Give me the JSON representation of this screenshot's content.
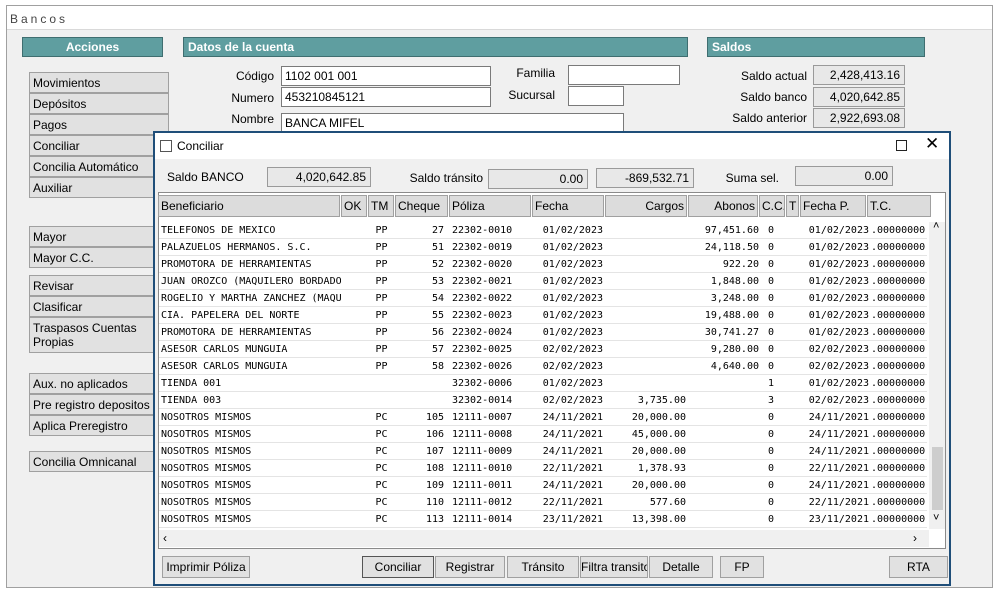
{
  "window": {
    "title": "Bancos"
  },
  "actions": {
    "header": "Acciones",
    "buttons": [
      {
        "id": "movimientos",
        "label": "Movimientos"
      },
      {
        "id": "depositos",
        "label": "Depósitos"
      },
      {
        "id": "pagos",
        "label": "Pagos"
      },
      {
        "id": "conciliar",
        "label": "Conciliar"
      },
      {
        "id": "concilia-automatico",
        "label": "Concilia Automático"
      },
      {
        "id": "auxiliar",
        "label": "Auxiliar"
      },
      {
        "id": "mayor",
        "label": "Mayor"
      },
      {
        "id": "mayor-cc",
        "label": "Mayor C.C."
      },
      {
        "id": "revisar",
        "label": "Revisar"
      },
      {
        "id": "clasificar",
        "label": "Clasificar"
      },
      {
        "id": "traspasos",
        "label": "Traspasos  Cuentas Propias"
      },
      {
        "id": "aux-no-aplicados",
        "label": "Aux. no aplicados"
      },
      {
        "id": "pre-registro",
        "label": "Pre registro depositos"
      },
      {
        "id": "aplica-preregistro",
        "label": "Aplica Preregistro"
      },
      {
        "id": "concilia-omnicanal",
        "label": "Concilia Omnicanal"
      }
    ]
  },
  "account": {
    "header": "Datos de la cuenta",
    "codigo_label": "Código",
    "codigo": "1102 001 001",
    "numero_label": "Numero",
    "numero": "453210845121",
    "nombre_label": "Nombre",
    "nombre": "BANCA MIFEL",
    "familia_label": "Familia",
    "familia": "",
    "sucursal_label": "Sucursal",
    "sucursal": ""
  },
  "saldos": {
    "header": "Saldos",
    "actual_label": "Saldo actual",
    "actual": "2,428,413.16",
    "banco_label": "Saldo banco",
    "banco": "4,020,642.85",
    "anterior_label": "Saldo anterior",
    "anterior": "2,922,693.08"
  },
  "dialog": {
    "title": "Conciliar",
    "saldo_banco_label": "Saldo BANCO",
    "saldo_banco": "4,020,642.85",
    "saldo_transito_label": "Saldo tránsito",
    "saldo_transito": "0.00",
    "saldo_transito2": "-869,532.71",
    "suma_sel_label": "Suma sel.",
    "suma_sel": "0.00",
    "columns": {
      "beneficiario": "Beneficiario",
      "ok": "OK",
      "tm": "TM",
      "cheque": "Cheque",
      "poliza": "Póliza",
      "fecha": "Fecha",
      "cargos": "Cargos",
      "abonos": "Abonos",
      "cc": "C.C.",
      "t": "T",
      "fechap": "Fecha P.",
      "tc": "T.C."
    },
    "rows": [
      {
        "ben": "TELEFONOS DE MEXICO",
        "ok": "",
        "tm": "PP",
        "chq": "27",
        "pol": "22302-0010",
        "fec": "01/02/2023",
        "car": "",
        "abo": "97,451.60",
        "cc": "0",
        "fp": "01/02/2023",
        "tc": ".00000000"
      },
      {
        "ben": "PALAZUELOS HERMANOS. S.C.",
        "ok": "",
        "tm": "PP",
        "chq": "51",
        "pol": "22302-0019",
        "fec": "01/02/2023",
        "car": "",
        "abo": "24,118.50",
        "cc": "0",
        "fp": "01/02/2023",
        "tc": ".00000000"
      },
      {
        "ben": "PROMOTORA DE HERRAMIENTAS",
        "ok": "",
        "tm": "PP",
        "chq": "52",
        "pol": "22302-0020",
        "fec": "01/02/2023",
        "car": "",
        "abo": "922.20",
        "cc": "0",
        "fp": "01/02/2023",
        "tc": ".00000000"
      },
      {
        "ben": "JUAN OROZCO (MAQUILERO BORDADO",
        "ok": "",
        "tm": "PP",
        "chq": "53",
        "pol": "22302-0021",
        "fec": "01/02/2023",
        "car": "",
        "abo": "1,848.00",
        "cc": "0",
        "fp": "01/02/2023",
        "tc": ".00000000"
      },
      {
        "ben": "ROGELIO Y MARTHA ZANCHEZ (MAQU",
        "ok": "",
        "tm": "PP",
        "chq": "54",
        "pol": "22302-0022",
        "fec": "01/02/2023",
        "car": "",
        "abo": "3,248.00",
        "cc": "0",
        "fp": "01/02/2023",
        "tc": ".00000000"
      },
      {
        "ben": "CIA. PAPELERA DEL NORTE",
        "ok": "",
        "tm": "PP",
        "chq": "55",
        "pol": "22302-0023",
        "fec": "01/02/2023",
        "car": "",
        "abo": "19,488.00",
        "cc": "0",
        "fp": "01/02/2023",
        "tc": ".00000000"
      },
      {
        "ben": "PROMOTORA DE HERRAMIENTAS",
        "ok": "",
        "tm": "PP",
        "chq": "56",
        "pol": "22302-0024",
        "fec": "01/02/2023",
        "car": "",
        "abo": "30,741.27",
        "cc": "0",
        "fp": "01/02/2023",
        "tc": ".00000000"
      },
      {
        "ben": "ASESOR CARLOS MUNGUIA",
        "ok": "",
        "tm": "PP",
        "chq": "57",
        "pol": "22302-0025",
        "fec": "02/02/2023",
        "car": "",
        "abo": "9,280.00",
        "cc": "0",
        "fp": "02/02/2023",
        "tc": ".00000000"
      },
      {
        "ben": "ASESOR CARLOS MUNGUIA",
        "ok": "",
        "tm": "PP",
        "chq": "58",
        "pol": "22302-0026",
        "fec": "02/02/2023",
        "car": "",
        "abo": "4,640.00",
        "cc": "0",
        "fp": "02/02/2023",
        "tc": ".00000000"
      },
      {
        "ben": " TIENDA 001",
        "ok": "",
        "tm": "",
        "chq": "",
        "pol": "32302-0006",
        "fec": "01/02/2023",
        "car": "",
        "abo": "",
        "cc": "1",
        "fp": "01/02/2023",
        "tc": ".00000000"
      },
      {
        "ben": " TIENDA 003",
        "ok": "",
        "tm": "",
        "chq": "",
        "pol": "32302-0014",
        "fec": "02/02/2023",
        "car": "3,735.00",
        "abo": "",
        "cc": "3",
        "fp": "02/02/2023",
        "tc": ".00000000"
      },
      {
        "ben": "NOSOTROS MISMOS",
        "ok": "",
        "tm": "PC",
        "chq": "105",
        "pol": "12111-0007",
        "fec": "24/11/2021",
        "car": "20,000.00",
        "abo": "",
        "cc": "0",
        "fp": "24/11/2021",
        "tc": ".00000000"
      },
      {
        "ben": "NOSOTROS MISMOS",
        "ok": "",
        "tm": "PC",
        "chq": "106",
        "pol": "12111-0008",
        "fec": "24/11/2021",
        "car": "45,000.00",
        "abo": "",
        "cc": "0",
        "fp": "24/11/2021",
        "tc": ".00000000"
      },
      {
        "ben": "NOSOTROS MISMOS",
        "ok": "",
        "tm": "PC",
        "chq": "107",
        "pol": "12111-0009",
        "fec": "24/11/2021",
        "car": "20,000.00",
        "abo": "",
        "cc": "0",
        "fp": "24/11/2021",
        "tc": ".00000000"
      },
      {
        "ben": "NOSOTROS MISMOS",
        "ok": "",
        "tm": "PC",
        "chq": "108",
        "pol": "12111-0010",
        "fec": "22/11/2021",
        "car": "1,378.93",
        "abo": "",
        "cc": "0",
        "fp": "22/11/2021",
        "tc": ".00000000"
      },
      {
        "ben": "NOSOTROS MISMOS",
        "ok": "",
        "tm": "PC",
        "chq": "109",
        "pol": "12111-0011",
        "fec": "24/11/2021",
        "car": "20,000.00",
        "abo": "",
        "cc": "0",
        "fp": "24/11/2021",
        "tc": ".00000000"
      },
      {
        "ben": "NOSOTROS MISMOS",
        "ok": "",
        "tm": "PC",
        "chq": "110",
        "pol": "12111-0012",
        "fec": "22/11/2021",
        "car": "577.60",
        "abo": "",
        "cc": "0",
        "fp": "22/11/2021",
        "tc": ".00000000"
      },
      {
        "ben": "NOSOTROS MISMOS",
        "ok": "",
        "tm": "PC",
        "chq": "113",
        "pol": "12111-0014",
        "fec": "23/11/2021",
        "car": "13,398.00",
        "abo": "",
        "cc": "0",
        "fp": "23/11/2021",
        "tc": ".00000000"
      }
    ],
    "buttons": {
      "imprimir": "Imprimir Póliza",
      "conciliar": "Conciliar",
      "registrar": "Registrar",
      "transito": "Tránsito",
      "filtra": "Filtra transito",
      "detalle": "Detalle",
      "fp": "FP",
      "rta": "RTA"
    },
    "icons": {
      "checkbox": "square-icon",
      "maximize": "maximize-icon",
      "close": "close-icon"
    }
  }
}
